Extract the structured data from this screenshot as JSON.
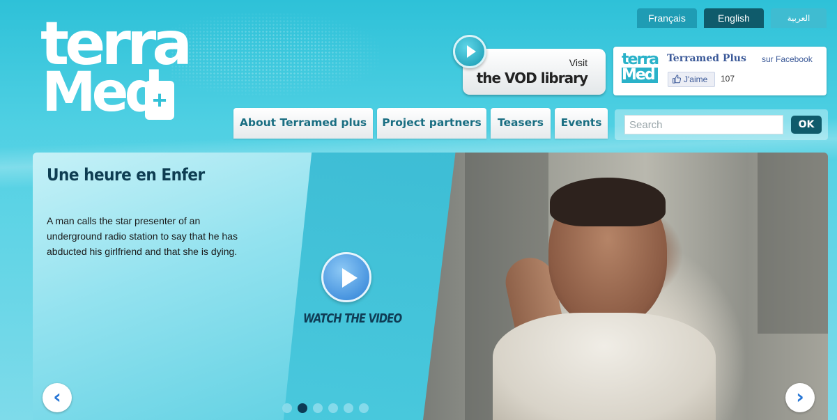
{
  "logo": {
    "line1": "terra",
    "line2": "Med",
    "plus": "+"
  },
  "languages": [
    {
      "label": "Français"
    },
    {
      "label": "English",
      "active": true
    },
    {
      "label": "العربية"
    }
  ],
  "vod": {
    "visit": "Visit",
    "title": "the VOD library"
  },
  "facebook": {
    "logo_top": "terra",
    "logo_bottom": "Med",
    "page_name": "Terramed Plus",
    "suffix": "sur Facebook",
    "like_label": "J'aime",
    "like_count": "107"
  },
  "nav": [
    {
      "label": "About Terramed plus"
    },
    {
      "label": "Project partners"
    },
    {
      "label": "Teasers"
    },
    {
      "label": "Events"
    }
  ],
  "search": {
    "placeholder": "Search",
    "button": "OK"
  },
  "hero": {
    "title": "Une heure en Enfer",
    "description": "A man calls the star presenter of an underground radio station to say that he has abducted his girlfriend and that she is dying.",
    "watch_label": "WATCH THE VIDEO",
    "prev_icon": "‹",
    "next_icon": "›",
    "slide_count": 6,
    "active_slide": 2
  },
  "colors": {
    "brand_teal": "#2ec1d8",
    "dark_teal": "#0f5b6b",
    "nav_text": "#1a6e82",
    "facebook_blue": "#3b5998"
  },
  "icons": [
    "play-icon",
    "thumbs-up-icon",
    "chevron-left-icon",
    "chevron-right-icon"
  ]
}
